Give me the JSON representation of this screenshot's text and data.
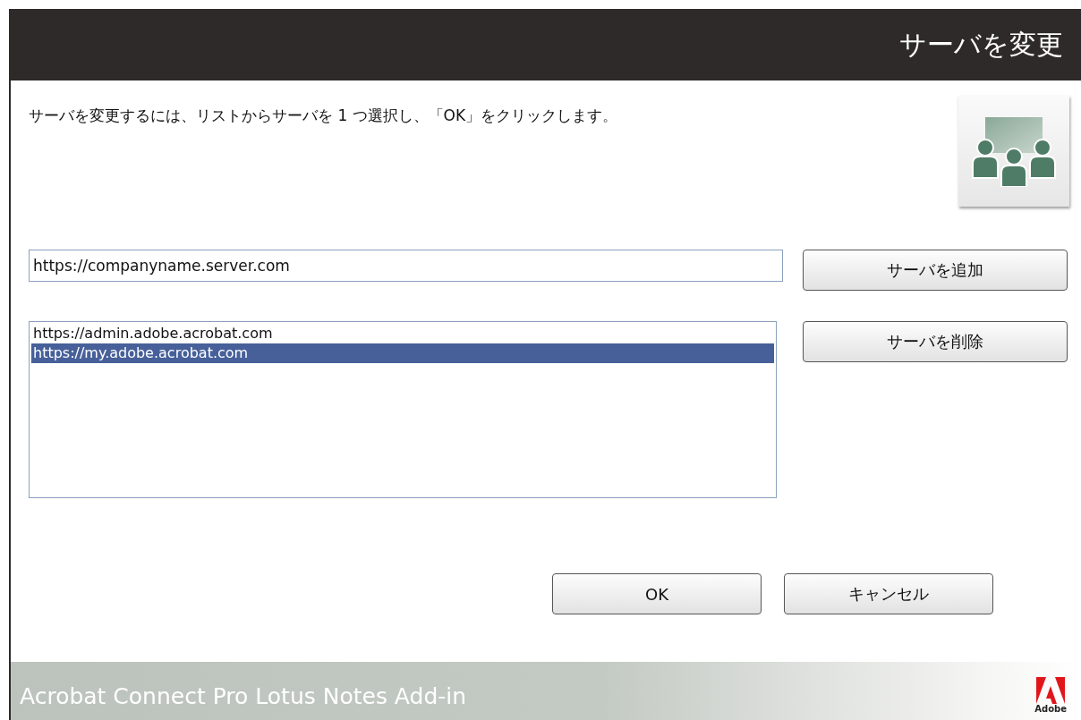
{
  "window": {
    "title": "サーバを変更"
  },
  "instruction": "サーバを変更するには、リストからサーバを 1 つ選択し、「OK」をクリックします。",
  "server_field": {
    "value": "https://companyname.server.com"
  },
  "add_button": "サーバを追加",
  "server_list": [
    {
      "label": "https://admin.adobe.acrobat.com",
      "selected": false
    },
    {
      "label": "https://my.adobe.acrobat.com",
      "selected": true
    }
  ],
  "remove_button": "サーバを削除",
  "buttons": [
    "OK",
    "キャンセル"
  ],
  "footer": {
    "product": "Acrobat Connect Pro Lotus Notes Add-in",
    "logo_caption": "Adobe"
  }
}
